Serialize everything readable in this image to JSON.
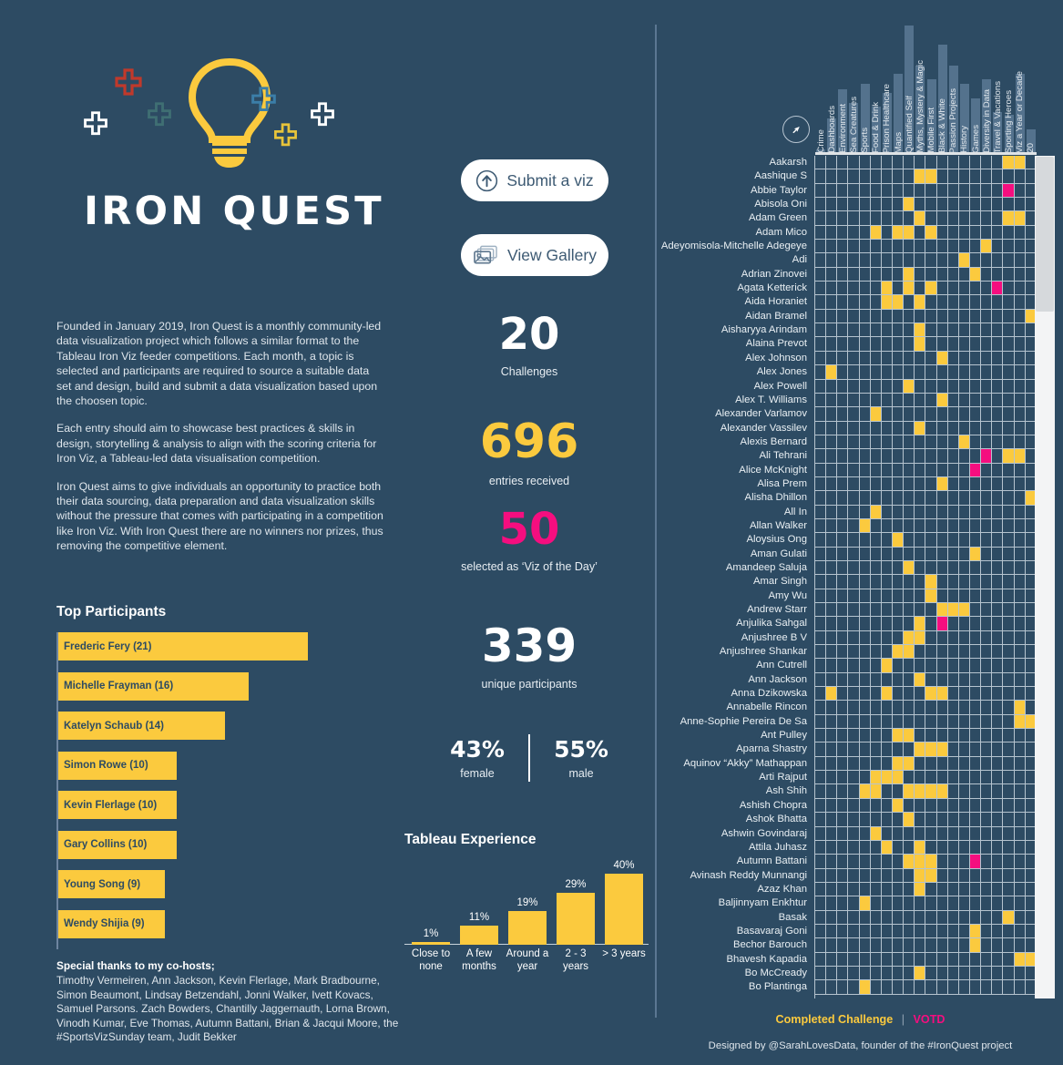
{
  "brand": {
    "title": "IRON QUEST",
    "logo_icon": "lightbulb-icon",
    "plus_icons": [
      "plus-red",
      "plus-white",
      "plus-teal",
      "plus-blue",
      "plus-white-2",
      "plus-yellow"
    ],
    "colors": {
      "background": "#2d4b63",
      "accent_yellow": "#fbca3e",
      "accent_pink": "#f50e7f",
      "text_light": "#dfe6ec",
      "white": "#ffffff",
      "grid_line": "#b6c4cf",
      "column_bar": "#5f7d99"
    }
  },
  "about": {
    "paragraphs": [
      "Founded in January 2019, Iron Quest is a monthly community-led data visualization project which follows a similar format to the Tableau Iron Viz feeder competitions. Each month, a topic is selected and participants are required to source a suitable data set and design, build and submit a data visualization based upon the choosen topic.",
      "Each entry should aim to showcase best practices & skills in design, storytelling & analysis to align with the scoring criteria for Iron Viz, a Tableau-led data visualisation competition.",
      "Iron Quest aims to give individuals an opportunity to practice both their data sourcing, data preparation and data visualization skills without the pressure that comes with participating in a competition like Iron Viz. With Iron Quest there are no winners nor prizes, thus removing the competitive element."
    ]
  },
  "buttons": {
    "submit": {
      "label": "Submit a viz",
      "icon": "arrow-up-circle-icon"
    },
    "gallery": {
      "label": "View Gallery",
      "icon": "images-stack-icon"
    }
  },
  "kpis": {
    "challenges": {
      "value": "20",
      "label": "Challenges",
      "color": "#ffffff"
    },
    "entries": {
      "value": "696",
      "label": "entries received",
      "color": "#fbca3e"
    },
    "votd": {
      "value": "50",
      "label": "selected as ‘Viz of the Day’",
      "color": "#f50e7f"
    },
    "unique": {
      "value": "339",
      "label": "unique participants",
      "color": "#ffffff"
    }
  },
  "gender": {
    "female": {
      "value": "43%",
      "label": "female"
    },
    "male": {
      "value": "55%",
      "label": "male"
    }
  },
  "top_participants": {
    "title": "Top Participants",
    "chart_data": {
      "type": "bar",
      "title": "Top Participants",
      "orientation": "horizontal",
      "categories": [
        "Frederic Fery",
        "Michelle Frayman",
        "Katelyn Schaub",
        "Simon Rowe",
        "Kevin Flerlage",
        "Gary Collins",
        "Young Song",
        "Wendy Shijia"
      ],
      "values": [
        21,
        16,
        14,
        10,
        10,
        10,
        9,
        9
      ],
      "labels": [
        "Frederic Fery (21)",
        "Michelle Frayman (16)",
        "Katelyn Schaub (14)",
        "Simon Rowe (10)",
        "Kevin Flerlage (10)",
        "Gary Collins (10)",
        "Young Song (9)",
        "Wendy Shijia (9)"
      ],
      "xlabel": "",
      "ylabel": "",
      "xlim": [
        0,
        23
      ],
      "grid": false,
      "legend": "none"
    }
  },
  "tableau_experience": {
    "title": "Tableau Experience",
    "chart_data": {
      "type": "bar",
      "title": "Tableau Experience",
      "categories": [
        "Close to none",
        "A few months",
        "Around a year",
        "2 - 3 years",
        "> 3 years"
      ],
      "values": [
        1,
        11,
        19,
        29,
        40
      ],
      "value_labels": [
        "1%",
        "11%",
        "19%",
        "29%",
        "40%"
      ],
      "xlabel": "",
      "ylabel": "",
      "ylim": [
        0,
        44
      ],
      "grid": false,
      "legend": "none"
    }
  },
  "thanks": {
    "title": "Special thanks to my co-hosts;",
    "body": "Timothy Vermeiren, Ann Jackson, Kevin Flerlage, Mark Bradbourne, Simon Beaumont, Lindsay Betzendahl, Jonni Walker, Ivett Kovacs, Samuel Parsons. Zach Bowders, Chantilly Jaggernauth, Lorna Brown, Vinodh Kumar, Eve Thomas, Autumn Battani, Brian & Jacqui Moore, the #SportsVizSunday team, Judit Bekker"
  },
  "matrix": {
    "cursor_icon": "pointer-arrow-circle-icon",
    "chart_data": {
      "type": "heatmap",
      "title": "Participant Challenge Completion Matrix",
      "columns": [
        "Crime",
        "Dashboards",
        "Environment",
        "Sea Creatures",
        "Sports",
        "Food & Drink",
        "Prison Healthcare",
        "Maps",
        "Quantified Self",
        "Myths, Mystery & Magic",
        "Mobile First",
        "Black & White",
        "Passion Projects",
        "History",
        "Games",
        "Diversity in Data",
        "Travel & Vacations",
        "Sporting Heroes",
        "Viz a Year or Decade",
        "20"
      ],
      "column_totals": [
        3,
        21,
        38,
        30,
        41,
        28,
        36,
        47,
        75,
        52,
        44,
        64,
        52,
        41,
        33,
        44,
        25,
        23,
        47,
        15
      ],
      "legend": {
        "completed": "Completed Challenge",
        "votd": "VOTD",
        "separator": "|"
      },
      "rows": [
        {
          "name": "Aakarsh",
          "completed": [
            17,
            18
          ],
          "votd": []
        },
        {
          "name": "Aashique S",
          "completed": [
            9,
            10
          ],
          "votd": []
        },
        {
          "name": "Abbie Taylor",
          "completed": [],
          "votd": [
            17
          ]
        },
        {
          "name": "Abisola Oni",
          "completed": [
            8
          ],
          "votd": []
        },
        {
          "name": "Adam Green",
          "completed": [
            9,
            17,
            18
          ],
          "votd": []
        },
        {
          "name": "Adam Mico",
          "completed": [
            5,
            7,
            8,
            10
          ],
          "votd": []
        },
        {
          "name": "Adeyomisola-Mitchelle Adegeye",
          "completed": [
            15
          ],
          "votd": []
        },
        {
          "name": "Adi",
          "completed": [
            13
          ],
          "votd": []
        },
        {
          "name": "Adrian Zinovei",
          "completed": [
            8,
            14
          ],
          "votd": []
        },
        {
          "name": "Agata Ketterick",
          "completed": [
            6,
            8,
            10
          ],
          "votd": [
            16
          ]
        },
        {
          "name": "Aida Horaniet",
          "completed": [
            6,
            7,
            9
          ],
          "votd": []
        },
        {
          "name": "Aidan Bramel",
          "completed": [
            19
          ],
          "votd": []
        },
        {
          "name": "Aisharyya Arindam",
          "completed": [
            9
          ],
          "votd": []
        },
        {
          "name": "Alaina Prevot",
          "completed": [
            9
          ],
          "votd": []
        },
        {
          "name": "Alex Johnson",
          "completed": [
            11
          ],
          "votd": []
        },
        {
          "name": "Alex Jones",
          "completed": [
            1
          ],
          "votd": []
        },
        {
          "name": "Alex Powell",
          "completed": [
            8
          ],
          "votd": []
        },
        {
          "name": "Alex T. Williams",
          "completed": [
            11
          ],
          "votd": []
        },
        {
          "name": "Alexander Varlamov",
          "completed": [
            5
          ],
          "votd": []
        },
        {
          "name": "Alexander Vassilev",
          "completed": [
            9
          ],
          "votd": []
        },
        {
          "name": "Alexis Bernard",
          "completed": [
            13
          ],
          "votd": []
        },
        {
          "name": "Ali Tehrani",
          "completed": [
            17,
            18
          ],
          "votd": [
            15
          ]
        },
        {
          "name": "Alice McKnight",
          "completed": [],
          "votd": [
            14
          ]
        },
        {
          "name": "Alisa Prem",
          "completed": [
            11
          ],
          "votd": []
        },
        {
          "name": "Alisha Dhillon",
          "completed": [
            19
          ],
          "votd": []
        },
        {
          "name": "All In",
          "completed": [
            5
          ],
          "votd": []
        },
        {
          "name": "Allan Walker",
          "completed": [
            4
          ],
          "votd": []
        },
        {
          "name": "Aloysius Ong",
          "completed": [
            7
          ],
          "votd": []
        },
        {
          "name": "Aman Gulati",
          "completed": [
            14
          ],
          "votd": []
        },
        {
          "name": "Amandeep Saluja",
          "completed": [
            8
          ],
          "votd": []
        },
        {
          "name": "Amar Singh",
          "completed": [
            10
          ],
          "votd": []
        },
        {
          "name": "Amy Wu",
          "completed": [
            10
          ],
          "votd": []
        },
        {
          "name": "Andrew Starr",
          "completed": [
            11,
            12,
            13
          ],
          "votd": []
        },
        {
          "name": "Anjulika Sahgal",
          "completed": [
            9
          ],
          "votd": [
            11
          ]
        },
        {
          "name": "Anjushree B V",
          "completed": [
            8,
            9
          ],
          "votd": []
        },
        {
          "name": "Anjushree Shankar",
          "completed": [
            7,
            8
          ],
          "votd": []
        },
        {
          "name": "Ann Cutrell",
          "completed": [
            6
          ],
          "votd": []
        },
        {
          "name": "Ann Jackson",
          "completed": [
            9
          ],
          "votd": []
        },
        {
          "name": "Anna Dzikowska",
          "completed": [
            1,
            6,
            10,
            11
          ],
          "votd": []
        },
        {
          "name": "Annabelle Rincon",
          "completed": [
            18
          ],
          "votd": []
        },
        {
          "name": "Anne-Sophie Pereira De Sa",
          "completed": [
            18,
            19
          ],
          "votd": []
        },
        {
          "name": "Ant Pulley",
          "completed": [
            7,
            8
          ],
          "votd": []
        },
        {
          "name": "Aparna Shastry",
          "completed": [
            9,
            10,
            11
          ],
          "votd": []
        },
        {
          "name": "Aquinov “Akky” Mathappan",
          "completed": [
            7,
            8
          ],
          "votd": []
        },
        {
          "name": "Arti Rajput",
          "completed": [
            5,
            6,
            7
          ],
          "votd": []
        },
        {
          "name": "Ash Shih",
          "completed": [
            4,
            5,
            8,
            9,
            10,
            11
          ],
          "votd": []
        },
        {
          "name": "Ashish Chopra",
          "completed": [
            7
          ],
          "votd": []
        },
        {
          "name": "Ashok Bhatta",
          "completed": [
            8
          ],
          "votd": []
        },
        {
          "name": "Ashwin Govindaraj",
          "completed": [
            5
          ],
          "votd": []
        },
        {
          "name": "Attila Juhasz",
          "completed": [
            6,
            9
          ],
          "votd": []
        },
        {
          "name": "Autumn Battani",
          "completed": [
            8,
            9,
            10
          ],
          "votd": [
            14
          ]
        },
        {
          "name": "Avinash Reddy Munnangi",
          "completed": [
            9,
            10
          ],
          "votd": []
        },
        {
          "name": "Azaz Khan",
          "completed": [
            9
          ],
          "votd": []
        },
        {
          "name": "Baljinnyam Enkhtur",
          "completed": [
            4
          ],
          "votd": []
        },
        {
          "name": "Basak",
          "completed": [
            17
          ],
          "votd": []
        },
        {
          "name": "Basavaraj Goni",
          "completed": [
            14
          ],
          "votd": []
        },
        {
          "name": "Bechor Barouch",
          "completed": [
            14
          ],
          "votd": []
        },
        {
          "name": "Bhavesh Kapadia",
          "completed": [
            18,
            19
          ],
          "votd": []
        },
        {
          "name": "Bo McCready",
          "completed": [
            9
          ],
          "votd": []
        },
        {
          "name": "Bo Plantinga",
          "completed": [
            4
          ],
          "votd": []
        }
      ]
    }
  },
  "credit": "Designed by @SarahLovesData, founder of the #IronQuest project"
}
